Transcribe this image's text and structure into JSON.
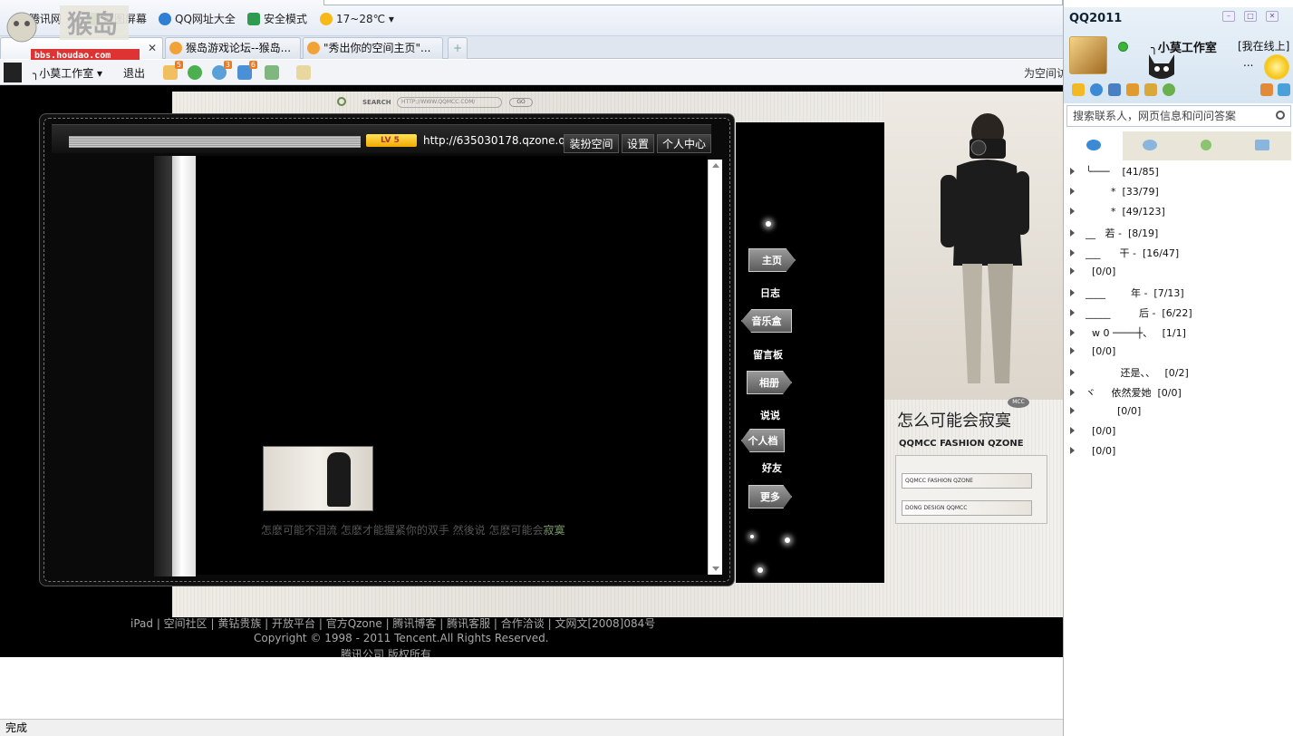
{
  "favorites": [
    {
      "label": "腾讯网",
      "icon": "qq-globe-icon",
      "color": "#4a90d9"
    },
    {
      "label": "截图屏幕",
      "icon": "screenshot-icon",
      "color": "#6aa84f"
    },
    {
      "label": "QQ网址大全",
      "icon": "qq-globe-icon",
      "color": "#2f7fd4"
    },
    {
      "label": "安全模式",
      "icon": "shield-icon",
      "color": "#2e9b4e"
    },
    {
      "label": "17~28℃",
      "icon": "weather-sun-icon",
      "color": "#f6b918"
    }
  ],
  "logo": {
    "text": "猴岛",
    "url": "bbs.houdao.com"
  },
  "tabs": [
    {
      "label": ""
    },
    {
      "label": "猴岛游戏论坛--猴岛..."
    },
    {
      "label": "\"秀出你的空间主页\"..."
    }
  ],
  "toolbar": {
    "user": "╮小莫工作室",
    "logout": "退出",
    "badges": [
      "5",
      "3",
      "6"
    ],
    "right_text": "为空间访"
  },
  "site_search": {
    "label": "SEARCH",
    "placeholder": "HTTP://WWW.QQMCC.COM/",
    "go": "GO"
  },
  "space": {
    "level": "LV 5",
    "url": "http://635030178.qzone.qq",
    "buttons": [
      "装扮空间",
      "设置",
      "个人中心"
    ],
    "caption_main": "怎麽可能不泪流  怎麽才能握紧你的双手  然後说  怎麽可能会",
    "caption_highlight": "寂寞"
  },
  "nav": [
    "主页",
    "日志",
    "音乐盒",
    "留言板",
    "相册",
    "说说",
    "个人档",
    "好友",
    "更多"
  ],
  "theme": {
    "slogan": "怎么可能会寂寞",
    "slogan_sub": "QQMCC FASHION QZONE",
    "badge": "MCC",
    "bar1": "QQMCC FASHION QZONE",
    "bar2": "DONG DESIGN QQMCC"
  },
  "footer": {
    "links": "iPad | 空间社区  | 黄钻贵族  | 开放平台  | 官方Qzone | 腾讯博客  | 腾讯客服  | 合作洽谈  | 文网文[2008]084号",
    "copyright": "Copyright © 1998 - 2011 Tencent.All Rights Reserved.",
    "company": "腾讯公司  版权所有"
  },
  "statusbar": "完成",
  "qq": {
    "title": "QQ2011",
    "nickname": "╮小莫工作室",
    "status": "[我在线上]",
    "ellipsis": "...",
    "search_placeholder": "搜索联系人，网页信息和问问答案",
    "groups": [
      "╰───    [41/85]",
      "        *  [33/79]",
      "        *  [49/123]",
      "__   若 -  [8/19]",
      "___      干 -  [16/47]",
      "  [0/0]",
      "____        年 -  [7/13]",
      "_____         后 -  [6/22]",
      "  w 0 ────┼、   [1/1]",
      "  [0/0]",
      "           还是、、   [0/2]",
      "ヾ     依然爱她  [0/0]",
      "          [0/0]",
      "  [0/0]",
      "  [0/0]"
    ]
  },
  "colors": {
    "accent": "#3b8ad6",
    "lv_badge": "#f3a900",
    "caption_highlight": "#7a9a6a"
  }
}
